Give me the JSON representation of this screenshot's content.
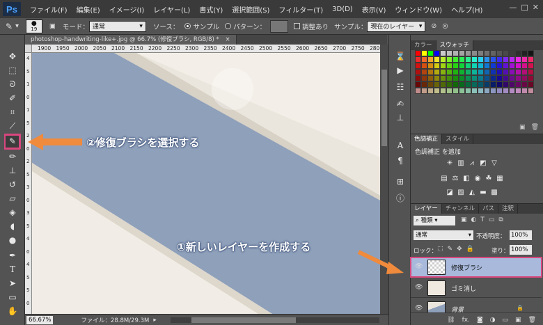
{
  "menubar": {
    "logo": "Ps",
    "items": [
      "ファイル(F)",
      "編集(E)",
      "イメージ(I)",
      "レイヤー(L)",
      "書式(Y)",
      "選択範囲(S)",
      "フィルター(T)",
      "3D(D)",
      "表示(V)",
      "ウィンドウ(W)",
      "ヘルプ(H)"
    ],
    "window_controls": [
      "—",
      "□",
      "✕"
    ]
  },
  "options": {
    "brush_size": "19",
    "mode_label": "モード：",
    "mode_value": "通常",
    "source_label": "ソース：",
    "sampled_label": "サンプル",
    "pattern_label": "パターン：",
    "aligned_label": "調整あり",
    "sample_label": "サンプル：",
    "sample_value": "現在のレイヤー"
  },
  "document": {
    "tab_title": "photoshop-handwriting-like+.jpg @ 66.7% (修復ブラシ, RGB/8) *",
    "close": "×",
    "ruler_ticks": [
      "1900",
      "1950",
      "2000",
      "2050",
      "2100",
      "2150",
      "2200",
      "2250",
      "2300",
      "2350",
      "2400",
      "2450",
      "2500",
      "2550",
      "2600",
      "2650",
      "2700",
      "2750",
      "2800"
    ],
    "vruler_ticks": [
      "4",
      "5",
      "1",
      "0",
      "1",
      "5",
      "2",
      "0",
      "2",
      "5",
      "3",
      "0",
      "3",
      "5",
      "4",
      "0",
      "4",
      "5",
      "5",
      "0"
    ]
  },
  "status": {
    "zoom": "66.67%",
    "file_info": "ファイル：28.8M/29.3M"
  },
  "panels": {
    "color_tabs": [
      "カラー",
      "スウォッチ"
    ],
    "adjust_tabs": [
      "色調補正",
      "スタイル"
    ],
    "adjust_add_label": "色調補正 を追加",
    "layer_tabs": [
      "レイヤー",
      "チャンネル",
      "パス",
      "注釈"
    ],
    "filter_kind": "種類",
    "blend_mode": "通常",
    "opacity_label": "不透明度：",
    "opacity_value": "100%",
    "lock_label": "ロック：",
    "fill_label": "塗り：",
    "fill_value": "100%",
    "layers": [
      {
        "name": "修復ブラシ",
        "selected": true
      },
      {
        "name": "ゴミ消し",
        "selected": false
      },
      {
        "name": "背景",
        "selected": false
      }
    ]
  },
  "annotations": {
    "step1": "①新しいレイヤーを作成する",
    "step2": "②修復ブラシを選択する"
  },
  "colors": {
    "highlight": "#d8477e",
    "arrow": "#f08a3c",
    "selected_layer": "#a8b9dc"
  }
}
